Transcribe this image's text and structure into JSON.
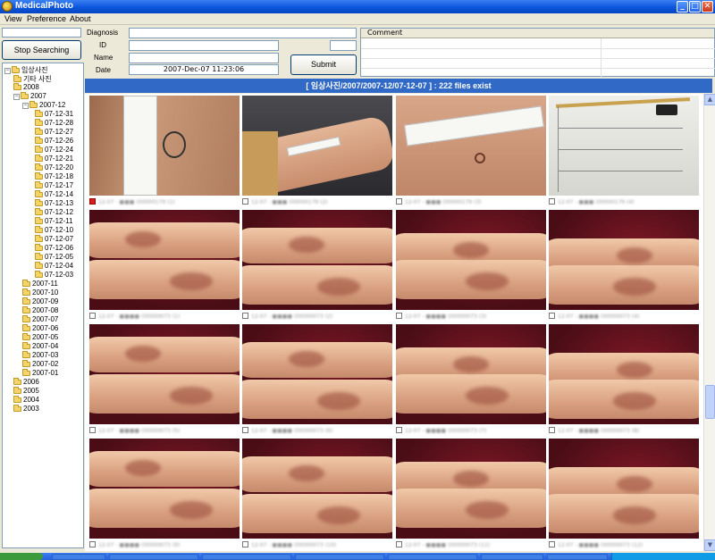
{
  "window": {
    "title": "MedicalPhoto",
    "buttons": {
      "minimize": "_",
      "maximize": "□",
      "close": "✕"
    }
  },
  "menu": [
    "View",
    "Preference",
    "About"
  ],
  "left_panel": {
    "search_value": "",
    "stop_button": "Stop Searching"
  },
  "tree": {
    "root": "임상사진",
    "items": [
      {
        "label": "기타 사진",
        "level": 1,
        "expander": ""
      },
      {
        "label": "2008",
        "level": 1,
        "expander": ""
      },
      {
        "label": "2007",
        "level": 1,
        "expander": "−"
      },
      {
        "label": "2007-12",
        "level": 2,
        "expander": "−"
      },
      {
        "label": "07-12-31",
        "level": 3
      },
      {
        "label": "07-12-28",
        "level": 3
      },
      {
        "label": "07-12-27",
        "level": 3
      },
      {
        "label": "07-12-26",
        "level": 3
      },
      {
        "label": "07-12-24",
        "level": 3
      },
      {
        "label": "07-12-21",
        "level": 3
      },
      {
        "label": "07-12-20",
        "level": 3
      },
      {
        "label": "07-12-18",
        "level": 3
      },
      {
        "label": "07-12-17",
        "level": 3
      },
      {
        "label": "07-12-14",
        "level": 3
      },
      {
        "label": "07-12-13",
        "level": 3
      },
      {
        "label": "07-12-12",
        "level": 3
      },
      {
        "label": "07-12-11",
        "level": 3
      },
      {
        "label": "07-12-10",
        "level": 3
      },
      {
        "label": "07-12-07",
        "level": 3
      },
      {
        "label": "07-12-06",
        "level": 3
      },
      {
        "label": "07-12-05",
        "level": 3
      },
      {
        "label": "07-12-04",
        "level": 3
      },
      {
        "label": "07-12-03",
        "level": 3
      },
      {
        "label": "2007-11",
        "level": 2
      },
      {
        "label": "2007-10",
        "level": 2
      },
      {
        "label": "2007-09",
        "level": 2
      },
      {
        "label": "2007-08",
        "level": 2
      },
      {
        "label": "2007-07",
        "level": 2
      },
      {
        "label": "2007-06",
        "level": 2
      },
      {
        "label": "2007-05",
        "level": 2
      },
      {
        "label": "2007-04",
        "level": 2
      },
      {
        "label": "2007-03",
        "level": 2
      },
      {
        "label": "2007-02",
        "level": 2
      },
      {
        "label": "2007-01",
        "level": 2
      },
      {
        "label": "2006",
        "level": 1
      },
      {
        "label": "2005",
        "level": 1
      },
      {
        "label": "2004",
        "level": 1
      },
      {
        "label": "2003",
        "level": 1
      }
    ]
  },
  "form": {
    "diagnosis_label": "Diagnosis",
    "id_label": "ID",
    "name_label": "Name",
    "date_label": "Date",
    "diagnosis_value": "",
    "id_value": "",
    "name_value": "",
    "date_value": "2007-Dec-07 11:23:06",
    "submit_label": "Submit"
  },
  "comment": {
    "header": "Comment"
  },
  "path_bar": {
    "text": "[ 임상사진/2007/2007-12/07-12-07 ] :  222 files exist"
  },
  "photos": [
    {
      "scene": "wrist-label",
      "caption": "12-07 - ■■■ (00000179 (1)",
      "checked": true
    },
    {
      "scene": "arm-marker",
      "caption": "12-07 - ■■■ (00000179 (2)",
      "checked": false
    },
    {
      "scene": "arm-ruler",
      "caption": "12-07 - ■■■ (00000179 (3)",
      "checked": false
    },
    {
      "scene": "document",
      "caption": "12-07 - ■■■ (00000179 (4)",
      "checked": false
    },
    {
      "scene": "legs",
      "caption": "12-07 - ■■■■ (00000073 (1)",
      "checked": false
    },
    {
      "scene": "legs",
      "caption": "12-07 - ■■■■ (00000073 (2)",
      "checked": false
    },
    {
      "scene": "legs",
      "caption": "12-07 - ■■■■ (00000073 (3)",
      "checked": false
    },
    {
      "scene": "legs",
      "caption": "12-07 - ■■■■ (00000073 (4)",
      "checked": false
    },
    {
      "scene": "legs",
      "caption": "12-07 - ■■■■ (00000073 (5)",
      "checked": false
    },
    {
      "scene": "legs",
      "caption": "12-07 - ■■■■ (00000073 (6)",
      "checked": false
    },
    {
      "scene": "legs",
      "caption": "12-07 - ■■■■ (00000073 (7)",
      "checked": false
    },
    {
      "scene": "legs",
      "caption": "12-07 - ■■■■ (00000073 (8)",
      "checked": false
    },
    {
      "scene": "legs",
      "caption": "12-07 - ■■■■ (00000073 (9)",
      "checked": false
    },
    {
      "scene": "legs",
      "caption": "12-07 - ■■■■ (00000073 (10)",
      "checked": false
    },
    {
      "scene": "legs",
      "caption": "12-07 - ■■■■ (00000073 (11)",
      "checked": false
    },
    {
      "scene": "legs",
      "caption": "12-07 - ■■■■ (00000073 (12)",
      "checked": false
    }
  ],
  "colors": {
    "title_bar": "#0a53d8",
    "path_bar": "#3169c6",
    "selected_checkbox": "#d81c1c"
  }
}
